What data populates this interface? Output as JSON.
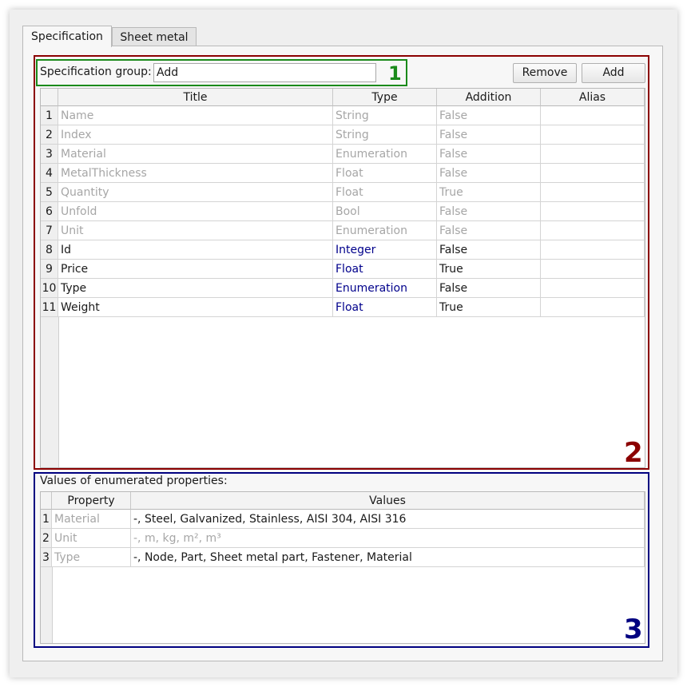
{
  "tabs": [
    {
      "label": "Specification"
    },
    {
      "label": "Sheet metal"
    }
  ],
  "group": {
    "label": "Specification group:",
    "value": "Add"
  },
  "buttons": {
    "remove": "Remove",
    "add": "Add"
  },
  "annotations": {
    "n1": "1",
    "n2": "2",
    "n3": "3"
  },
  "spec_table": {
    "columns": [
      "Title",
      "Type",
      "Addition",
      "Alias"
    ],
    "rows": [
      {
        "n": "1",
        "title": "Name",
        "type": "String",
        "addition": "False",
        "alias": ""
      },
      {
        "n": "2",
        "title": "Index",
        "type": "String",
        "addition": "False",
        "alias": ""
      },
      {
        "n": "3",
        "title": "Material",
        "type": "Enumeration",
        "addition": "False",
        "alias": ""
      },
      {
        "n": "4",
        "title": "MetalThickness",
        "type": "Float",
        "addition": "False",
        "alias": ""
      },
      {
        "n": "5",
        "title": "Quantity",
        "type": "Float",
        "addition": "True",
        "alias": ""
      },
      {
        "n": "6",
        "title": "Unfold",
        "type": "Bool",
        "addition": "False",
        "alias": ""
      },
      {
        "n": "7",
        "title": "Unit",
        "type": "Enumeration",
        "addition": "False",
        "alias": ""
      },
      {
        "n": "8",
        "title": "Id",
        "type": "Integer",
        "addition": "False",
        "alias": ""
      },
      {
        "n": "9",
        "title": "Price",
        "type": "Float",
        "addition": "True",
        "alias": ""
      },
      {
        "n": "10",
        "title": "Type",
        "type": "Enumeration",
        "addition": "False",
        "alias": ""
      },
      {
        "n": "11",
        "title": "Weight",
        "type": "Float",
        "addition": "True",
        "alias": ""
      }
    ]
  },
  "enum_section": {
    "label": "Values of enumerated properties:",
    "columns": [
      "Property",
      "Values"
    ],
    "rows": [
      {
        "n": "1",
        "property": "Material",
        "values": "-, Steel, Galvanized, Stainless, AISI 304, AISI 316"
      },
      {
        "n": "2",
        "property": "Unit",
        "values": "-, m, kg, m², m³"
      },
      {
        "n": "3",
        "property": "Type",
        "values": "-, Node, Part, Sheet metal part, Fastener, Material"
      }
    ]
  },
  "colors": {
    "annotation_1": "#1a8a1a",
    "annotation_2": "#8b0000",
    "annotation_3": "#000080",
    "type_text": "#00008b",
    "disabled_text": "#a6a6a6"
  }
}
